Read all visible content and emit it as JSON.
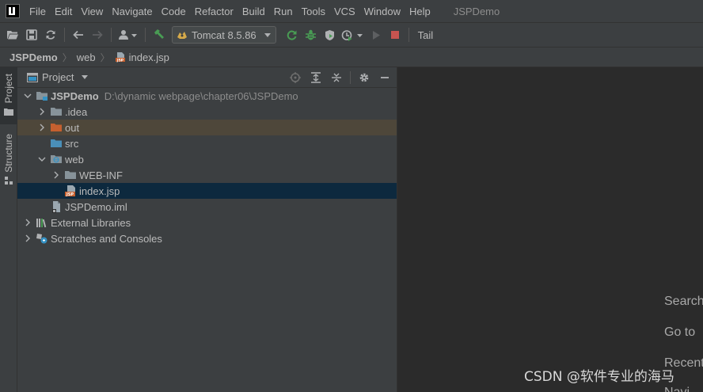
{
  "menubar": {
    "items": [
      "File",
      "Edit",
      "View",
      "Navigate",
      "Code",
      "Refactor",
      "Build",
      "Run",
      "Tools",
      "VCS",
      "Window",
      "Help"
    ],
    "window_title": "JSPDemo"
  },
  "toolbar": {
    "run_config": "Tomcat 8.5.86",
    "tail_label": "Tail"
  },
  "breadcrumb": {
    "items": [
      "JSPDemo",
      "web",
      "index.jsp"
    ]
  },
  "tool_stripe": {
    "project_label": "Project",
    "structure_label": "Structure"
  },
  "project_panel": {
    "title": "Project",
    "tree": {
      "root_name": "JSPDemo",
      "root_path": "D:\\dynamic webpage\\chapter06\\JSPDemo",
      "idea": ".idea",
      "out": "out",
      "src": "src",
      "web": "web",
      "web_inf": "WEB-INF",
      "index_jsp": "index.jsp",
      "iml": "JSPDemo.iml",
      "external_libraries": "External Libraries",
      "scratches": "Scratches and Consoles"
    }
  },
  "editor": {
    "hints": [
      "Search",
      "Go to",
      "Recent",
      "Navi"
    ]
  },
  "watermark": "CSDN @软件专业的海马",
  "colors": {
    "accent_selected": "#0d293e",
    "excluded_highlight": "#4e473a",
    "folder_blue": "#87939a",
    "folder_orange": "#c5602f"
  }
}
